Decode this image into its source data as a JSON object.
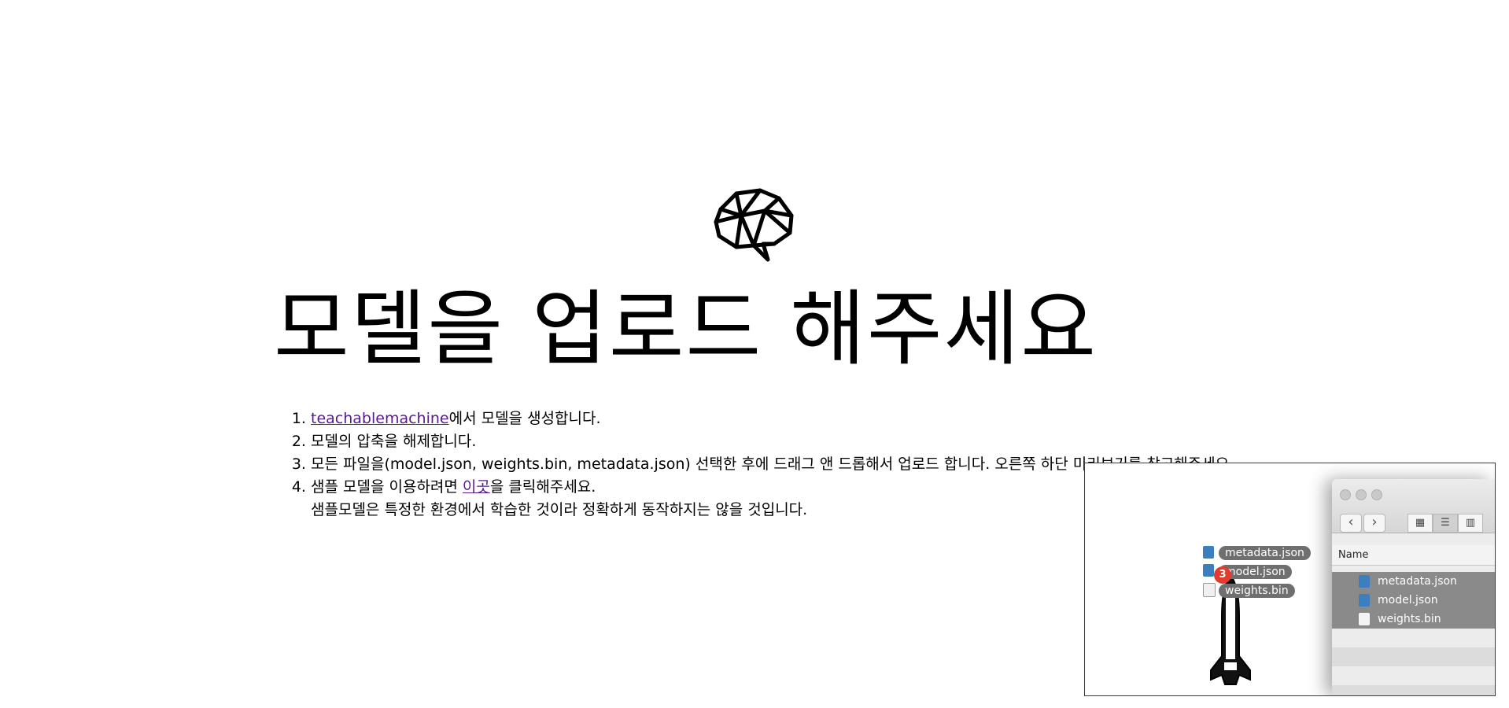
{
  "page": {
    "title": "모델을 업로드 해주세요"
  },
  "steps": [
    {
      "link": "teachablemachine",
      "text": "에서 모델을 생성합니다."
    },
    {
      "text": "모델의 압축을 해제합니다."
    },
    {
      "text": "모든 파일을(model.json, weights.bin, metadata.json) 선택한 후에 드래그 앤 드롭해서 업로드 합니다. 오른쪽 하단 미리보기를 참고해주세요."
    },
    {
      "text_before": "샘플 모델을 이용하려면 ",
      "link": "이곳",
      "text_after": "을 클릭해주세요.",
      "note": "샘플모델은 특정한 환경에서 학습한 것이라 정확하게 동작하지는 않을 것입니다."
    }
  ],
  "colors": {
    "link": "#551a8b",
    "selected_row": "#8a8a8a",
    "badge": "#e43b2f"
  },
  "preview": {
    "icons": [
      "brain-icon",
      "rocket-icon",
      "json-file-icon",
      "bin-file-icon"
    ],
    "drag_labels": [
      "metadata.json",
      "model.json",
      "weights.bin"
    ],
    "drag_count": "3",
    "finder": {
      "column_header": "Name",
      "back": "‹",
      "forward": "›",
      "files": [
        "metadata.json",
        "model.json",
        "weights.bin"
      ]
    }
  }
}
